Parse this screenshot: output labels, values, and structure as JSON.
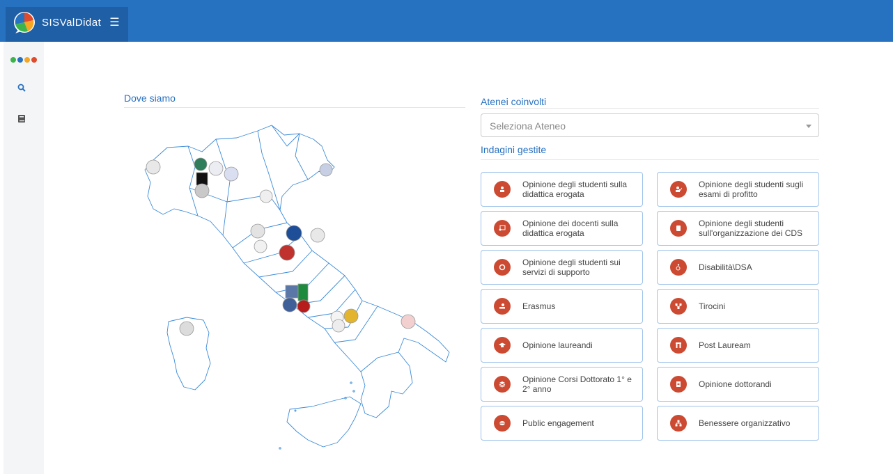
{
  "app": {
    "name": "SISValDidat",
    "menu_icon": "hamburger-icon"
  },
  "sidebar": {
    "dot_colors": [
      "#3cb44b",
      "#2771c1",
      "#f5a623",
      "#e04b2b"
    ],
    "items": [
      {
        "icon": "search-icon"
      },
      {
        "icon": "book-icon"
      }
    ]
  },
  "map_section": {
    "title": "Dove siamo"
  },
  "universities": {
    "title": "Atenei coinvolti",
    "placeholder": "Seleziona Ateneo"
  },
  "surveys": {
    "title": "Indagini gestite",
    "accent": "#cc4a32",
    "items": [
      {
        "label": "Opinione degli studenti sulla didattica erogata",
        "icon": "student-icon"
      },
      {
        "label": "Opinione degli studenti sugli esami di profitto",
        "icon": "user-check-icon"
      },
      {
        "label": "Opinione dei docenti sulla didattica erogata",
        "icon": "chalkboard-teacher-icon"
      },
      {
        "label": "Opinione degli studenti sull'organizzazione dei CDS",
        "icon": "scroll-icon"
      },
      {
        "label": "Opinione degli studenti sui servizi di supporto",
        "icon": "life-ring-icon"
      },
      {
        "label": "Disabilità\\DSA",
        "icon": "accessibility-icon"
      },
      {
        "label": "Erasmus",
        "icon": "globe-hand-icon"
      },
      {
        "label": "Tirocini",
        "icon": "network-icon"
      },
      {
        "label": "Opinione laureandi",
        "icon": "graduation-cap-icon"
      },
      {
        "label": "Post Lauream",
        "icon": "archway-icon"
      },
      {
        "label": "Opinione Corsi Dottorato 1° e 2° anno",
        "icon": "layers-icon"
      },
      {
        "label": "Opinione dottorandi",
        "icon": "document-icon"
      },
      {
        "label": "Public engagement",
        "icon": "record-icon"
      },
      {
        "label": "Benessere organizzativo",
        "icon": "org-chart-icon"
      }
    ]
  }
}
